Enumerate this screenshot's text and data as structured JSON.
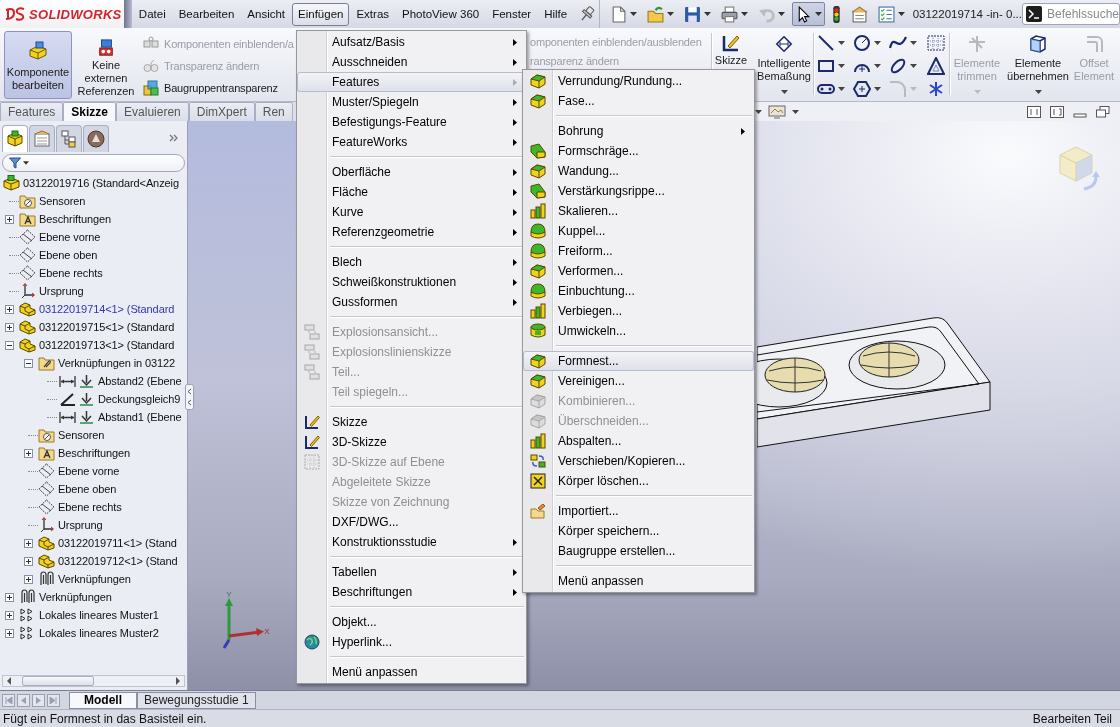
{
  "title_bar": {
    "logo": "SOLIDWORKS"
  },
  "menu_bar": [
    {
      "label": "Datei",
      "selected": false
    },
    {
      "label": "Bearbeiten",
      "selected": false
    },
    {
      "label": "Ansicht",
      "selected": false
    },
    {
      "label": "Einfügen",
      "selected": true
    },
    {
      "label": "Extras",
      "selected": false
    },
    {
      "label": "PhotoView 360",
      "selected": false
    },
    {
      "label": "Fenster",
      "selected": false
    },
    {
      "label": "Hilfe",
      "selected": false
    }
  ],
  "quick_toolbar": [
    {
      "disabled": false,
      "selected": false
    },
    {
      "disabled": false,
      "selected": false
    },
    {
      "disabled": false,
      "selected": false
    },
    {
      "disabled": false,
      "selected": false
    },
    {
      "disabled": true,
      "selected": false
    },
    {
      "disabled": false,
      "selected": true
    },
    {
      "disabled": false,
      "selected": false
    },
    {
      "disabled": false,
      "selected": false
    },
    {
      "disabled": false,
      "selected": false
    }
  ],
  "document_title": "03122019714 -in- 0...",
  "command_search": {
    "placeholder": "Befehlssuche"
  },
  "command_manager": {
    "assembly_buttons": [
      {
        "label": "Komponente bearbeiten",
        "selected": true
      },
      {
        "label": "Keine externen Referenzen",
        "selected": false
      }
    ],
    "assembly_options": [
      {
        "label": "Komponenten einblenden/a",
        "disabled": true
      },
      {
        "label": "Transparenz ändern",
        "disabled": true
      },
      {
        "label": "Baugruppentransparenz",
        "disabled": false
      }
    ],
    "assembly_options_repeat": [
      {
        "label": "omponenten einblenden/ausblenden",
        "disabled": true
      },
      {
        "label": "ransparenz ändern",
        "disabled": true
      }
    ],
    "sketch_buttons": [
      {
        "label": "Skizze",
        "disabled": false
      },
      {
        "label": "Intelligente Bemaßung",
        "disabled": false
      }
    ],
    "sketch_tools": [
      {
        "disabled": false
      },
      {
        "disabled": false
      },
      {
        "disabled": false
      },
      {
        "disabled": false
      },
      {
        "disabled": false
      },
      {
        "disabled": false
      },
      {
        "disabled": false
      },
      {
        "disabled": false
      },
      {
        "disabled": false
      },
      {
        "disabled": false
      },
      {
        "disabled": true
      },
      {
        "disabled": false
      }
    ],
    "edit_buttons": [
      {
        "label": "Elemente trimmen",
        "disabled": true
      },
      {
        "label": "Elemente übernehmen",
        "disabled": false
      },
      {
        "label": "Offset Element",
        "disabled": true
      }
    ]
  },
  "tabs": [
    {
      "label": "Features",
      "selected": false
    },
    {
      "label": "Skizze",
      "selected": true
    },
    {
      "label": "Evaluieren",
      "selected": false
    },
    {
      "label": "DimXpert",
      "selected": false
    },
    {
      "label": "Ren",
      "selected": false
    }
  ],
  "feature_manager": {
    "tabs": [
      {
        "selected": true
      },
      {
        "selected": false
      },
      {
        "selected": false
      },
      {
        "selected": false
      }
    ],
    "tree": [
      {
        "label": "03122019716 (Standard<Anzeig",
        "kind": "assembly",
        "editing": false,
        "children": [
          {
            "label": "Sensoren",
            "kind": "sensors",
            "editing": false
          },
          {
            "label": "Beschriftungen",
            "kind": "annotations",
            "editing": false,
            "expanded": false
          },
          {
            "label": "Ebene vorne",
            "kind": "plane",
            "editing": false
          },
          {
            "label": "Ebene oben",
            "kind": "plane",
            "editing": false
          },
          {
            "label": "Ebene rechts",
            "kind": "plane",
            "editing": false
          },
          {
            "label": "Ursprung",
            "kind": "origin",
            "editing": false
          },
          {
            "label": "03122019714<1> (Standard",
            "kind": "component",
            "editing": true,
            "expanded": false
          },
          {
            "label": "03122019715<1> (Standard",
            "kind": "component",
            "editing": false,
            "expanded": false
          },
          {
            "label": "03122019713<1> (Standard",
            "kind": "component",
            "editing": false,
            "expanded": true,
            "children": [
              {
                "label": "Verknüpfungen in 03122",
                "kind": "matefolder",
                "editing": false,
                "expanded": true,
                "children": [
                  {
                    "label": "Abstand2 (Ebene",
                    "kind": "distance",
                    "editing": false
                  },
                  {
                    "label": "Deckungsgleich9",
                    "kind": "coincident",
                    "editing": false
                  },
                  {
                    "label": "Abstand1 (Ebene",
                    "kind": "distance",
                    "editing": false
                  }
                ]
              },
              {
                "label": "Sensoren",
                "kind": "sensors",
                "editing": false
              },
              {
                "label": "Beschriftungen",
                "kind": "annotations",
                "editing": false,
                "expanded": false
              },
              {
                "label": "Ebene vorne",
                "kind": "plane",
                "editing": false
              },
              {
                "label": "Ebene oben",
                "kind": "plane",
                "editing": false
              },
              {
                "label": "Ebene rechts",
                "kind": "plane",
                "editing": false
              },
              {
                "label": "Ursprung",
                "kind": "origin",
                "editing": false
              },
              {
                "label": "03122019711<1> (Stand",
                "kind": "component",
                "editing": false,
                "expanded": false
              },
              {
                "label": "03122019712<1> (Stand",
                "kind": "component",
                "editing": false,
                "expanded": false
              },
              {
                "label": "Verknüpfungen",
                "kind": "mates",
                "editing": false,
                "expanded": false
              }
            ]
          },
          {
            "label": "Verknüpfungen",
            "kind": "mates",
            "editing": false,
            "expanded": false
          },
          {
            "label": "Lokales lineares Muster1",
            "kind": "pattern",
            "editing": false,
            "expanded": false
          },
          {
            "label": "Lokales lineares Muster2",
            "kind": "pattern",
            "editing": false,
            "expanded": false
          }
        ]
      }
    ]
  },
  "viewport": {
    "triad": {
      "y_label": "Y",
      "x_label": "X"
    }
  },
  "insert_menu": {
    "groups": [
      [
        {
          "label": "Aufsatz/Basis",
          "submenu": true,
          "disabled": false,
          "selected": false
        },
        {
          "label": "Ausschneiden",
          "submenu": true,
          "disabled": false,
          "selected": false
        },
        {
          "label": "Features",
          "submenu": true,
          "disabled": false,
          "selected": true
        },
        {
          "label": "Muster/Spiegeln",
          "submenu": true,
          "disabled": false,
          "selected": false
        },
        {
          "label": "Befestigungs-Feature",
          "submenu": true,
          "disabled": false,
          "selected": false
        },
        {
          "label": "FeatureWorks",
          "submenu": true,
          "disabled": false,
          "selected": false
        }
      ],
      [
        {
          "label": "Oberfläche",
          "submenu": true,
          "disabled": false,
          "selected": false
        },
        {
          "label": "Fläche",
          "submenu": true,
          "disabled": false,
          "selected": false
        },
        {
          "label": "Kurve",
          "submenu": true,
          "disabled": false,
          "selected": false
        },
        {
          "label": "Referenzgeometrie",
          "submenu": true,
          "disabled": false,
          "selected": false
        }
      ],
      [
        {
          "label": "Blech",
          "submenu": true,
          "disabled": false,
          "selected": false
        },
        {
          "label": "Schweißkonstruktionen",
          "submenu": true,
          "disabled": false,
          "selected": false
        },
        {
          "label": "Gussformen",
          "submenu": true,
          "disabled": false,
          "selected": false
        }
      ],
      [
        {
          "label": "Explosionsansicht...",
          "submenu": false,
          "disabled": true,
          "selected": false
        },
        {
          "label": "Explosionslinienskizze",
          "submenu": false,
          "disabled": true,
          "selected": false
        },
        {
          "label": "Teil...",
          "submenu": false,
          "disabled": true,
          "selected": false
        },
        {
          "label": "Teil spiegeln...",
          "submenu": false,
          "disabled": true,
          "selected": false
        }
      ],
      [
        {
          "label": "Skizze",
          "submenu": false,
          "disabled": false,
          "selected": false
        },
        {
          "label": "3D-Skizze",
          "submenu": false,
          "disabled": false,
          "selected": false
        },
        {
          "label": "3D-Skizze auf Ebene",
          "submenu": false,
          "disabled": true,
          "selected": false
        },
        {
          "label": "Abgeleitete Skizze",
          "submenu": false,
          "disabled": true,
          "selected": false
        },
        {
          "label": "Skizze von Zeichnung",
          "submenu": false,
          "disabled": true,
          "selected": false
        },
        {
          "label": "DXF/DWG...",
          "submenu": false,
          "disabled": false,
          "selected": false
        },
        {
          "label": "Konstruktionsstudie",
          "submenu": true,
          "disabled": false,
          "selected": false
        }
      ],
      [
        {
          "label": "Tabellen",
          "submenu": true,
          "disabled": false,
          "selected": false
        },
        {
          "label": "Beschriftungen",
          "submenu": true,
          "disabled": false,
          "selected": false
        }
      ],
      [
        {
          "label": "Objekt...",
          "submenu": false,
          "disabled": false,
          "selected": false
        },
        {
          "label": "Hyperlink...",
          "submenu": false,
          "disabled": false,
          "selected": false
        }
      ],
      [
        {
          "label": "Menü anpassen",
          "submenu": false,
          "disabled": false,
          "selected": false
        }
      ]
    ]
  },
  "features_submenu": {
    "groups": [
      [
        {
          "label": "Verrundung/Rundung...",
          "submenu": false,
          "disabled": false,
          "selected": false
        },
        {
          "label": "Fase...",
          "submenu": false,
          "disabled": false,
          "selected": false
        }
      ],
      [
        {
          "label": "Bohrung",
          "submenu": true,
          "disabled": false,
          "selected": false
        },
        {
          "label": "Formschräge...",
          "submenu": false,
          "disabled": false,
          "selected": false
        },
        {
          "label": "Wandung...",
          "submenu": false,
          "disabled": false,
          "selected": false
        },
        {
          "label": "Verstärkungsrippe...",
          "submenu": false,
          "disabled": false,
          "selected": false
        },
        {
          "label": "Skalieren...",
          "submenu": false,
          "disabled": false,
          "selected": false
        },
        {
          "label": "Kuppel...",
          "submenu": false,
          "disabled": false,
          "selected": false
        },
        {
          "label": "Freiform...",
          "submenu": false,
          "disabled": false,
          "selected": false
        },
        {
          "label": "Verformen...",
          "submenu": false,
          "disabled": false,
          "selected": false
        },
        {
          "label": "Einbuchtung...",
          "submenu": false,
          "disabled": false,
          "selected": false
        },
        {
          "label": "Verbiegen...",
          "submenu": false,
          "disabled": false,
          "selected": false
        },
        {
          "label": "Umwickeln...",
          "submenu": false,
          "disabled": false,
          "selected": false
        }
      ],
      [
        {
          "label": "Formnest...",
          "submenu": false,
          "disabled": false,
          "selected": true
        },
        {
          "label": "Vereinigen...",
          "submenu": false,
          "disabled": false,
          "selected": false
        },
        {
          "label": "Kombinieren...",
          "submenu": false,
          "disabled": true,
          "selected": false
        },
        {
          "label": "Überschneiden...",
          "submenu": false,
          "disabled": true,
          "selected": false
        },
        {
          "label": "Abspalten...",
          "submenu": false,
          "disabled": false,
          "selected": false
        },
        {
          "label": "Verschieben/Kopieren...",
          "submenu": false,
          "disabled": false,
          "selected": false
        },
        {
          "label": "Körper löschen...",
          "submenu": false,
          "disabled": false,
          "selected": false
        }
      ],
      [
        {
          "label": "Importiert...",
          "submenu": false,
          "disabled": false,
          "selected": false
        },
        {
          "label": "Körper speichern...",
          "submenu": false,
          "disabled": false,
          "selected": false
        },
        {
          "label": "Baugruppe erstellen...",
          "submenu": false,
          "disabled": false,
          "selected": false
        }
      ],
      [
        {
          "label": "Menü anpassen",
          "submenu": false,
          "disabled": false,
          "selected": false
        }
      ]
    ]
  },
  "bottom_tabs": [
    {
      "label": "Modell",
      "selected": true
    },
    {
      "label": "Bewegungsstudie 1",
      "selected": false
    }
  ],
  "status_bar": {
    "message": "Fügt ein Formnest in das Basisteil ein.",
    "mode": "Bearbeiten Teil"
  }
}
